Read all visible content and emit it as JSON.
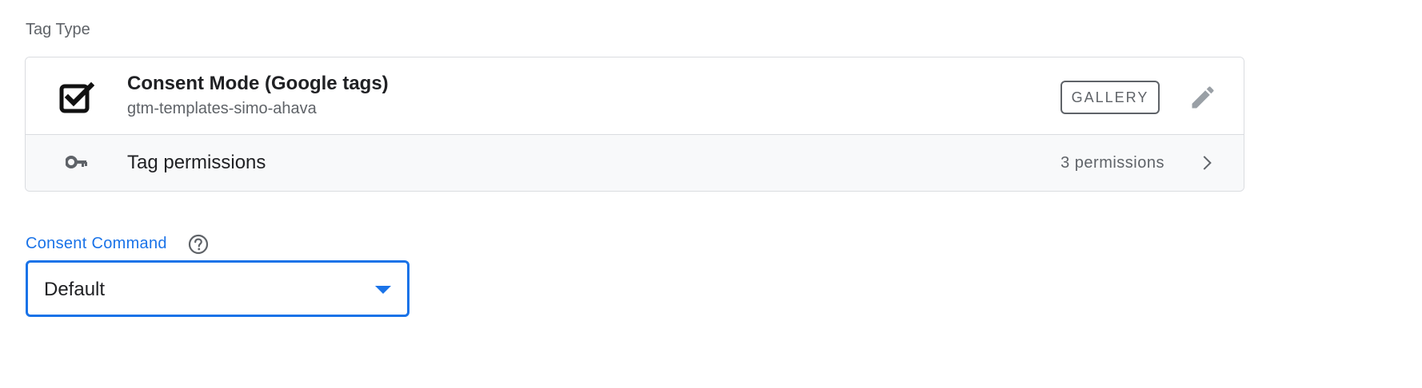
{
  "tag_type": {
    "section_label": "Tag Type",
    "template": {
      "title": "Consent Mode (Google tags)",
      "subtitle": "gtm-templates-simo-ahava",
      "icon": "checkbox-checked-icon",
      "gallery_label": "GALLERY",
      "edit_icon": "pencil-icon"
    },
    "permissions": {
      "icon": "key-icon",
      "label": "Tag permissions",
      "count_text": "3 permissions",
      "chevron_icon": "chevron-right-icon"
    }
  },
  "consent_command": {
    "label": "Consent Command",
    "help_icon": "help-circle-icon",
    "selected_value": "Default"
  },
  "colors": {
    "accent": "#1a73e8",
    "text_primary": "#202124",
    "text_secondary": "#5f6368",
    "border": "#dadce0",
    "row_bg": "#f8f9fa"
  }
}
